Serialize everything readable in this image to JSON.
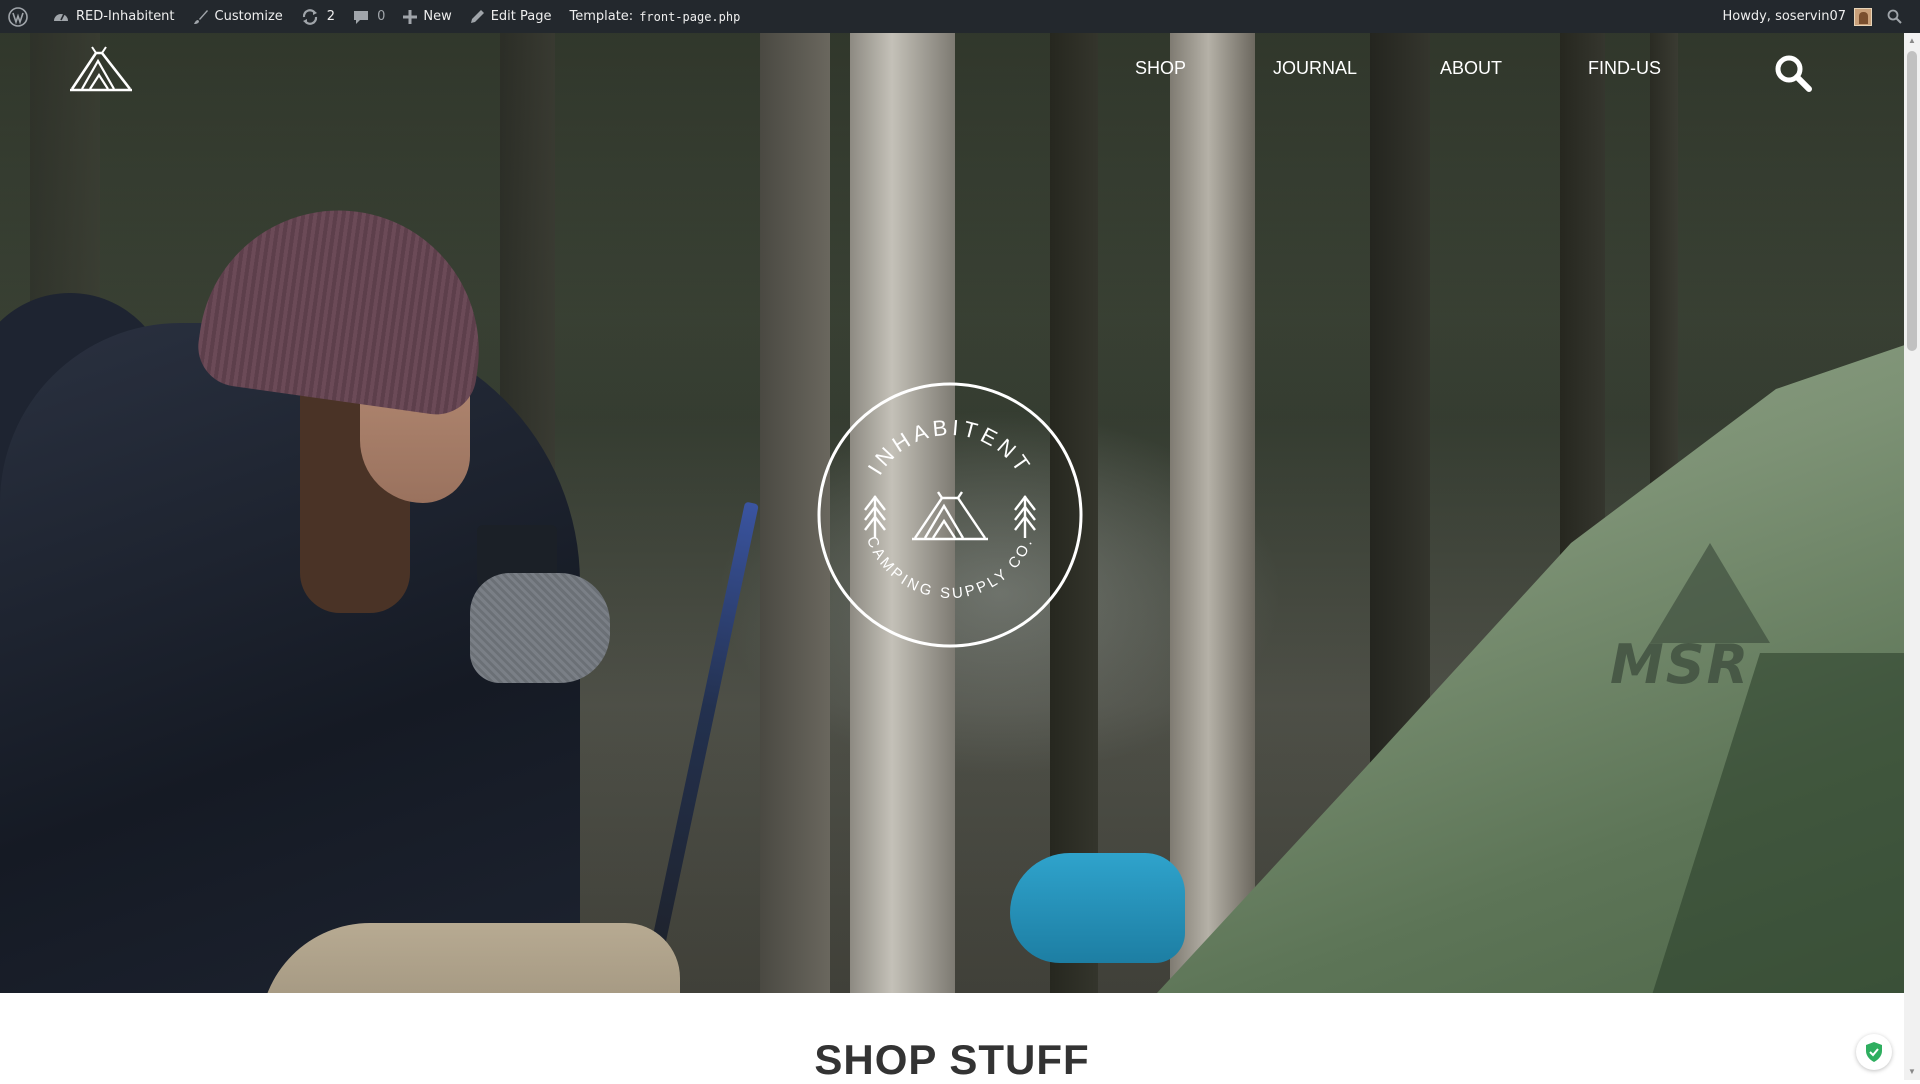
{
  "admin_bar": {
    "site_name": "RED-Inhabitent",
    "customize": "Customize",
    "updates_count": "2",
    "comments_count": "0",
    "new": "New",
    "edit_page": "Edit Page",
    "template_label": "Template:",
    "template_file": "front-page.php",
    "greeting": "Howdy, soservin07"
  },
  "site_nav": {
    "items": [
      "SHOP",
      "JOURNAL",
      "ABOUT",
      "FIND-US"
    ]
  },
  "emblem": {
    "brand_name": "INHABITENT",
    "tagline": "CAMPING SUPPLY CO."
  },
  "hero_photo": {
    "tent_brand": "MSR"
  },
  "shop_section": {
    "title": "SHOP STUFF"
  },
  "colors": {
    "admin_bar_bg": "#23282d",
    "admin_bar_text": "#eeeeee",
    "nav_text": "#ffffff",
    "heading_text": "#333333",
    "badge_green": "#2eae5f"
  },
  "icons": {
    "admin_bar": [
      "wordpress-logo-icon",
      "dashboard-icon",
      "brush-icon",
      "updates-icon",
      "comment-icon",
      "plus-icon",
      "pencil-icon",
      "search-icon"
    ],
    "site": [
      "tent-logo-icon",
      "search-icon",
      "shield-check-icon"
    ]
  }
}
